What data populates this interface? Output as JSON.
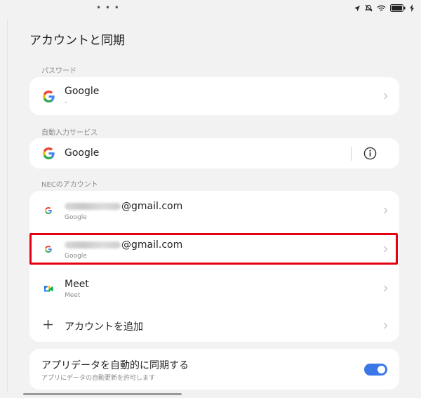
{
  "header": {
    "title": "アカウントと同期"
  },
  "password_section": {
    "label": "パスワード",
    "item": {
      "title": "Google",
      "subtitle": "–",
      "icon": "google-icon"
    }
  },
  "autofill_section": {
    "label": "自動入力サービス",
    "item": {
      "title": "Google",
      "icon": "google-icon",
      "info_icon": "info-icon"
    }
  },
  "accounts_section": {
    "label": "NECのアカウント",
    "accounts": [
      {
        "email_suffix": "@gmail.com",
        "provider": "Google",
        "icon": "google-icon"
      },
      {
        "email_suffix": "@gmail.com",
        "provider": "Google",
        "icon": "google-icon"
      },
      {
        "title": "Meet",
        "provider": "Meet",
        "icon": "meet-icon"
      }
    ],
    "add_account": {
      "label": "アカウントを追加",
      "icon": "plus-icon"
    }
  },
  "sync": {
    "title": "アプリデータを自動的に同期する",
    "subtitle": "アプリにデータの自動更新を許可します",
    "enabled": true
  },
  "colors": {
    "accent": "#3b77e6",
    "highlight": "#e50012",
    "background": "#f2f2f2"
  }
}
